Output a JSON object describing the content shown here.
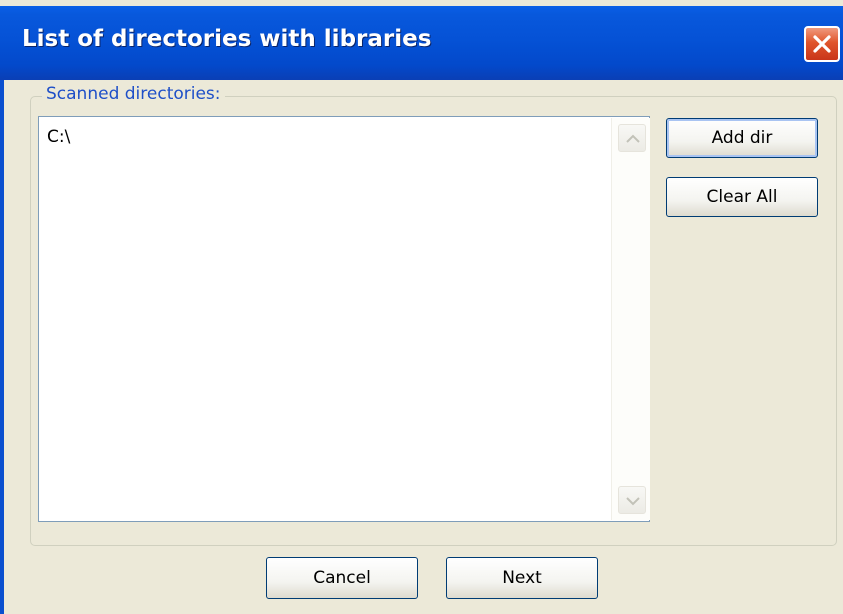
{
  "window": {
    "title": "List of directories with libraries",
    "close_icon": "close-icon",
    "title_bar_color": "#0552d6",
    "close_color": "#e0552b"
  },
  "group": {
    "label": "Scanned directories:",
    "label_color": "#1e4fc8"
  },
  "directory_list": {
    "items": [
      "C:\\"
    ],
    "scroll_up_icon": "chevron-up-icon",
    "scroll_down_icon": "chevron-down-icon"
  },
  "side_buttons": {
    "add_dir": "Add dir",
    "clear_all": "Clear All"
  },
  "footer_buttons": {
    "cancel": "Cancel",
    "next": "Next"
  }
}
